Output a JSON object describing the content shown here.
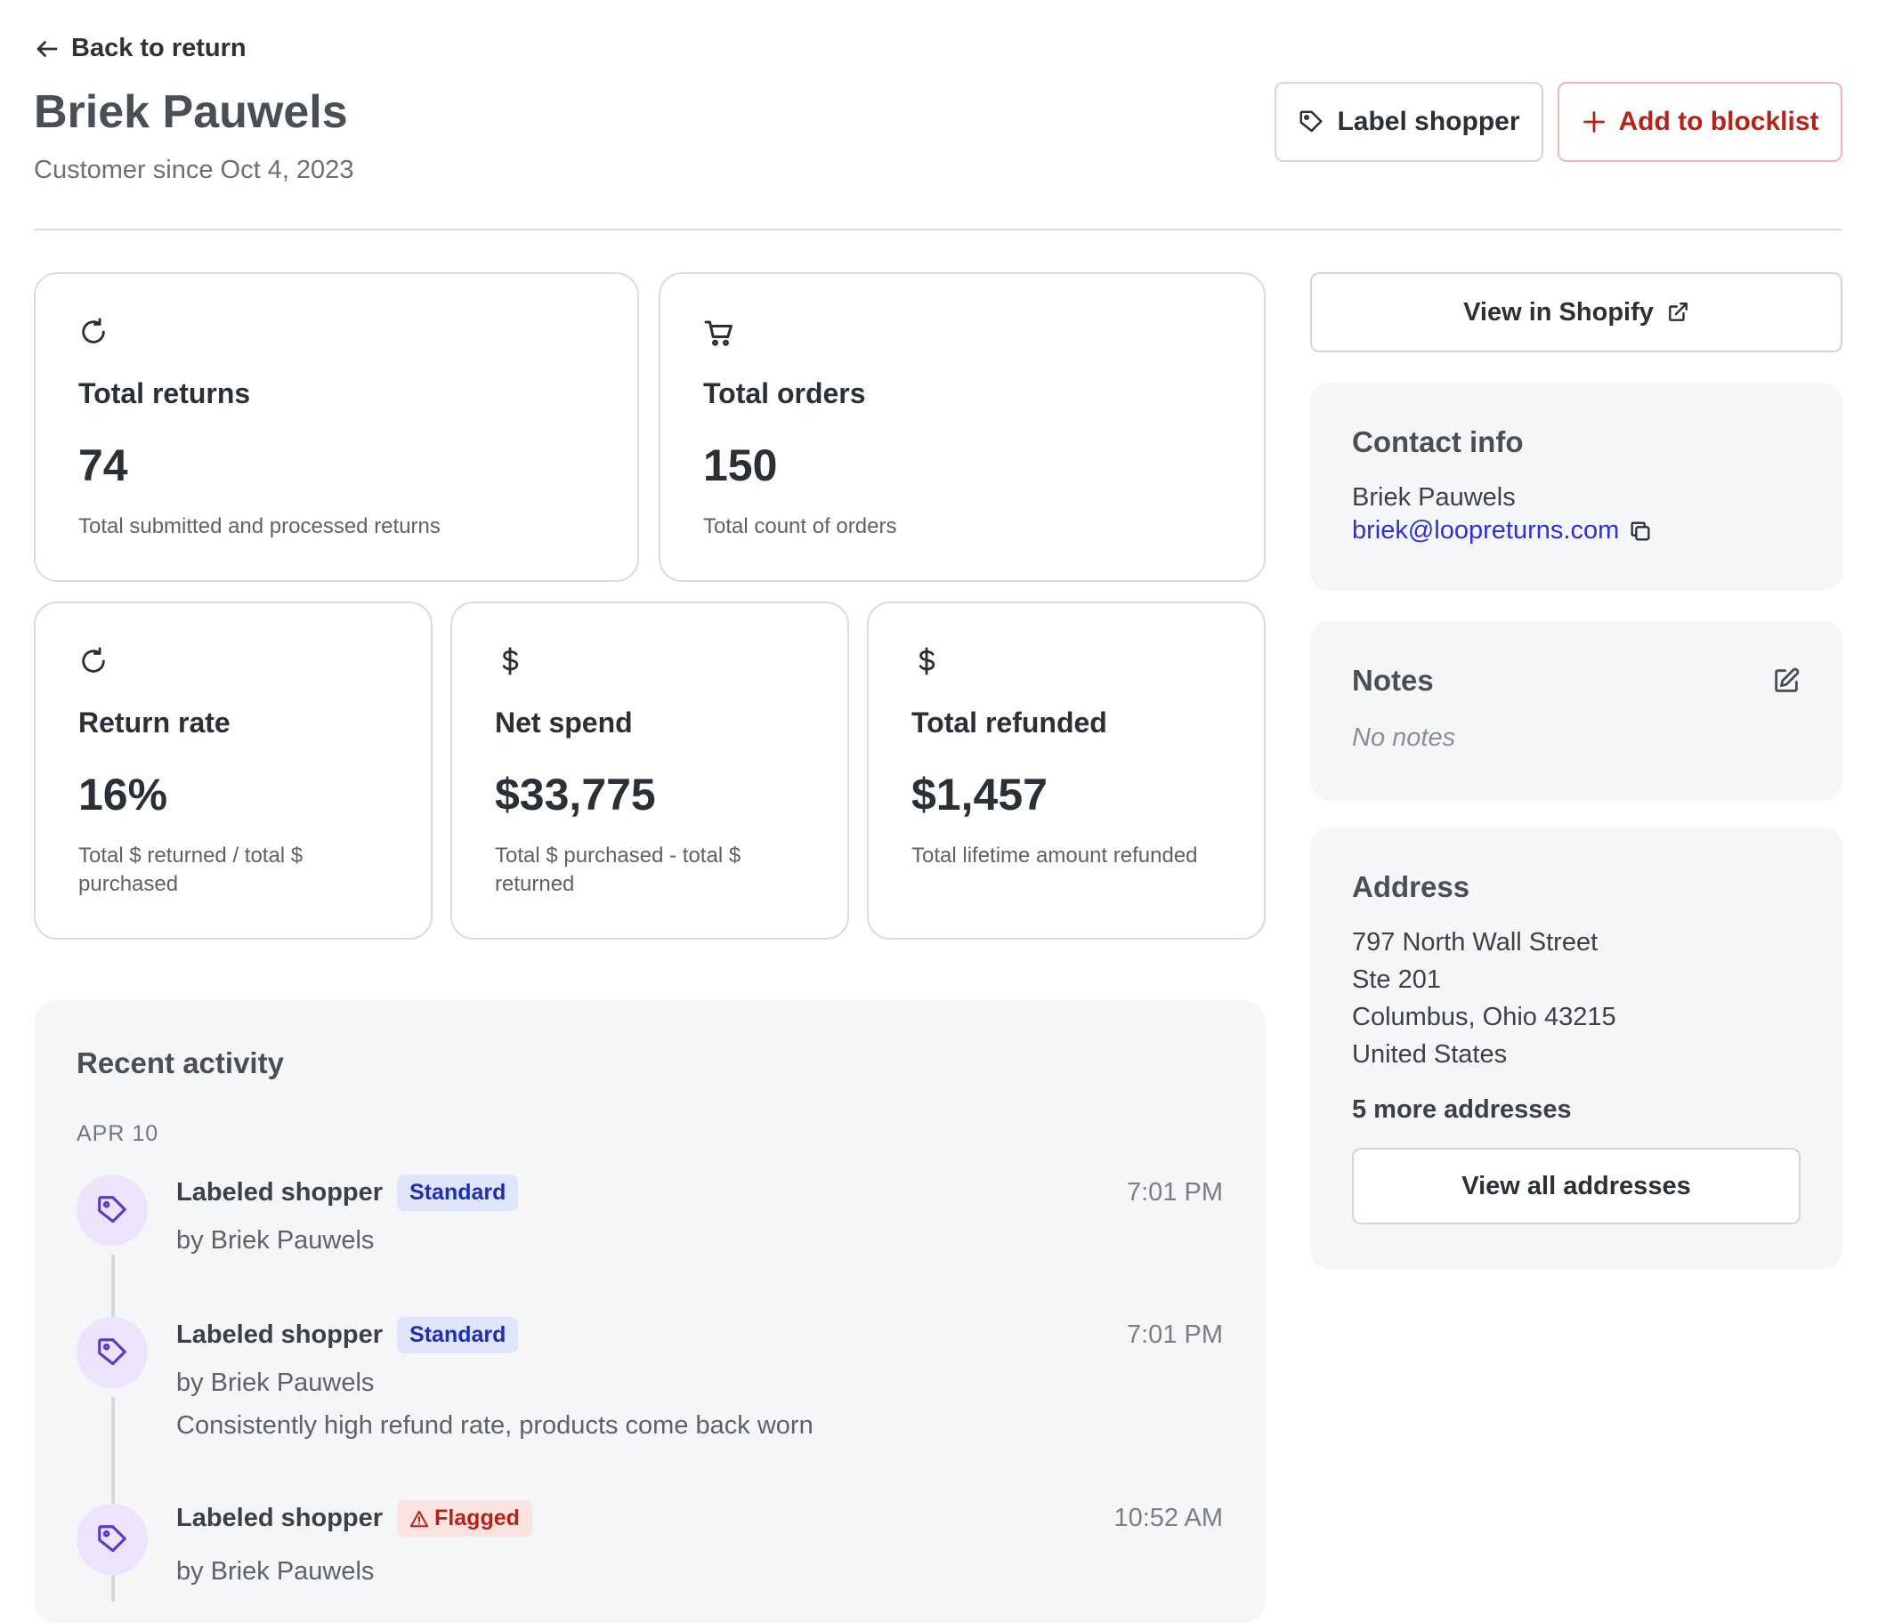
{
  "header": {
    "back_label": "Back to return",
    "customer_name": "Briek Pauwels",
    "customer_since": "Customer since Oct 4, 2023",
    "label_shopper_label": "Label shopper",
    "add_blocklist_label": "Add to blocklist"
  },
  "stats": {
    "total_returns": {
      "label": "Total returns",
      "value": "74",
      "description": "Total submitted and processed returns",
      "icon": "refresh-icon"
    },
    "total_orders": {
      "label": "Total orders",
      "value": "150",
      "description": "Total count of orders",
      "icon": "cart-icon"
    },
    "return_rate": {
      "label": "Return rate",
      "value": "16%",
      "description": "Total $ returned / total $ purchased",
      "icon": "refresh-icon"
    },
    "net_spend": {
      "label": "Net spend",
      "value": "$33,775",
      "description": "Total $ purchased - total $ returned",
      "icon": "dollar-icon"
    },
    "total_refunded": {
      "label": "Total refunded",
      "value": "$1,457",
      "description": "Total lifetime amount refunded",
      "icon": "dollar-icon"
    }
  },
  "sidebar": {
    "shopify_label": "View in Shopify",
    "contact": {
      "title": "Contact info",
      "name": "Briek Pauwels",
      "email": "briek@loopreturns.com"
    },
    "notes": {
      "title": "Notes",
      "empty_text": "No notes"
    },
    "address": {
      "title": "Address",
      "lines": [
        "797 North Wall Street",
        "Ste 201",
        "Columbus, Ohio 43215",
        "United States"
      ],
      "more_label": "5 more addresses",
      "view_all_label": "View all addresses"
    }
  },
  "activity": {
    "title": "Recent activity",
    "day": "APR 10",
    "events": [
      {
        "title": "Labeled shopper",
        "badge": "Standard",
        "by": "by Briek Pauwels",
        "note": "",
        "time": "7:01 PM"
      },
      {
        "title": "Labeled shopper",
        "badge": "Standard",
        "by": "by Briek Pauwels",
        "note": "Consistently high refund rate, products come back worn",
        "time": "7:01 PM"
      },
      {
        "title": "Labeled shopper",
        "badge": "Flagged",
        "by": "by Briek Pauwels",
        "note": "",
        "time": "10:52 AM"
      }
    ]
  },
  "colors": {
    "accent_link": "#2f2fd8",
    "danger": "#b42318",
    "badge_standard": "#1f2fb5"
  }
}
